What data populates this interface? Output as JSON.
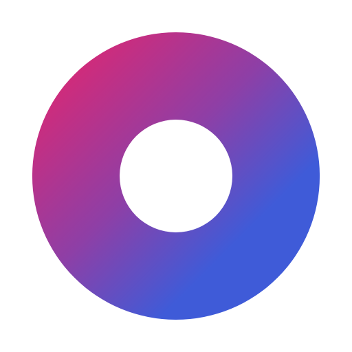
{
  "logo": {
    "name": "ring-logo",
    "colors": {
      "gradient_start": "#D42A78",
      "gradient_mid": "#8E3FA6",
      "gradient_end": "#3F5BD8",
      "hole": "#FFFFFF",
      "background": "#FFFFFF"
    }
  }
}
